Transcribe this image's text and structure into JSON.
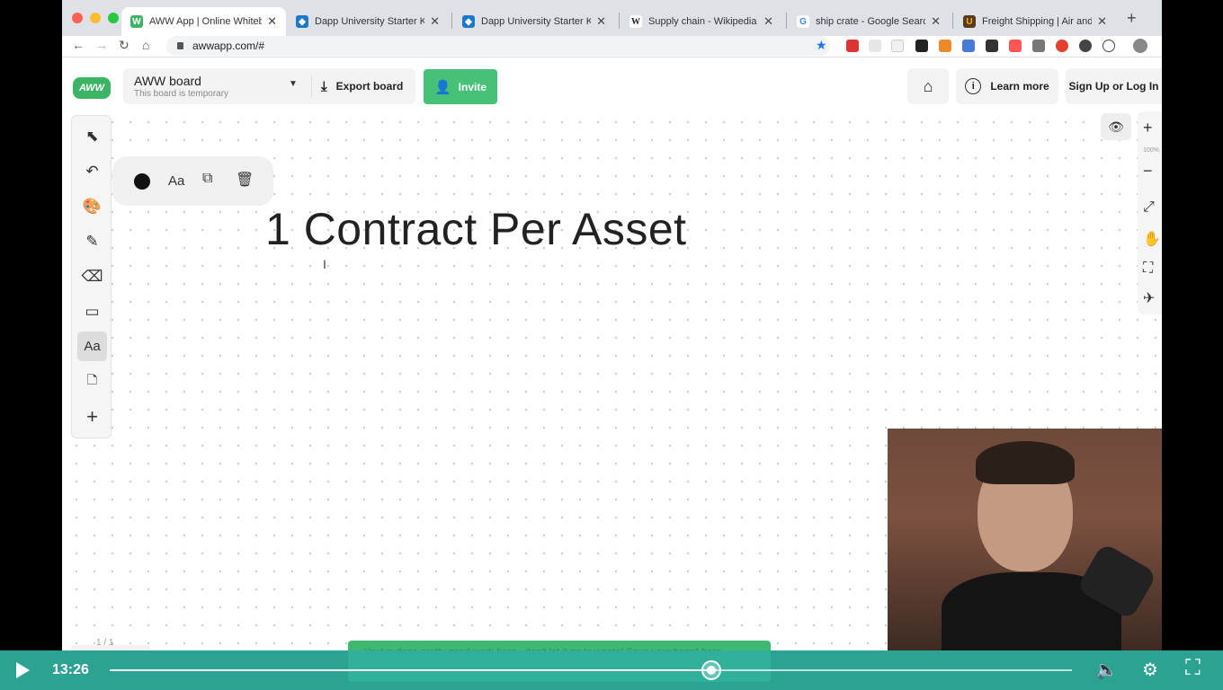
{
  "browser": {
    "tabs": [
      {
        "title": "AWW App | Online Whiteboa",
        "favicon": "aww-logo",
        "active": true
      },
      {
        "title": "Dapp University Starter Kit",
        "favicon": "vscode-icon",
        "active": false
      },
      {
        "title": "Dapp University Starter Kit",
        "favicon": "vscode-icon",
        "active": false
      },
      {
        "title": "Supply chain - Wikipedia",
        "favicon": "wikipedia-icon",
        "active": false
      },
      {
        "title": "ship crate - Google Search",
        "favicon": "google-icon",
        "active": false
      },
      {
        "title": "Freight Shipping | Air and Mo",
        "favicon": "ups-icon",
        "active": false
      }
    ],
    "url": "awwapp.com/#"
  },
  "app": {
    "logo_text": "AWW",
    "board_title": "AWW board",
    "board_subtitle": "This board is temporary",
    "export_label": "Export board",
    "invite_label": "Invite",
    "learn_more_label": "Learn more",
    "signup_label": "Sign Up or Log In",
    "text_tool_label": "Aa",
    "ctx_font_label": "Aa",
    "zoom_level": "100%"
  },
  "canvas": {
    "heading": "1 Contract Per Asset"
  },
  "toast": {
    "text": "You've done pretty good work here - don't let it go to waste! Save your board here."
  },
  "pagination": {
    "label": "1 / 1"
  },
  "video": {
    "time": "13:26",
    "progress": 0.625
  },
  "colors": {
    "accent": "#47c078",
    "controls": "#30b0a0"
  }
}
